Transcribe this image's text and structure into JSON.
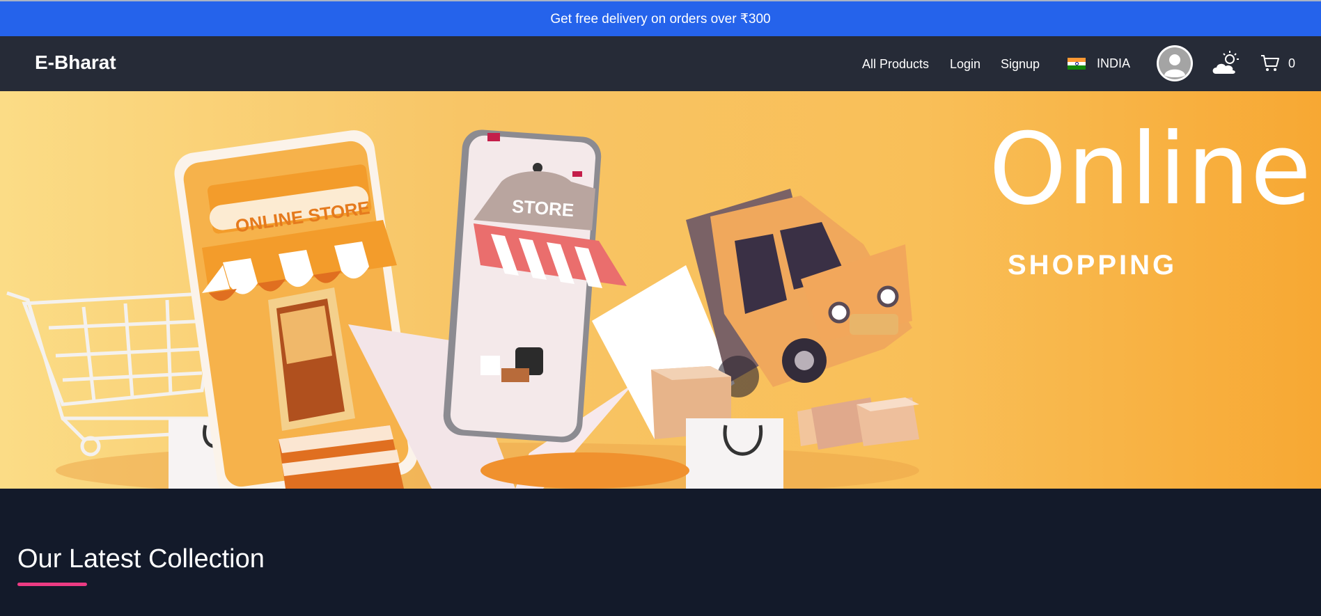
{
  "promo": {
    "text": "Get free delivery on orders over ₹300"
  },
  "navbar": {
    "brand": "E-Bharat",
    "links": {
      "all_products": "All Products",
      "login": "Login",
      "signup": "Signup"
    },
    "country": "INDIA",
    "cart_count": "0",
    "icons": [
      "india-flag-icon",
      "avatar-icon",
      "weather-icon",
      "cart-icon"
    ]
  },
  "hero": {
    "title": "Online.",
    "subtitle": "SHOPPING",
    "store_sign": "ONLINE STORE",
    "phone_sign": "STORE"
  },
  "section": {
    "title": "Our Latest Collection",
    "accent_color": "#ec3b83"
  },
  "colors": {
    "promo_bg": "#2563eb",
    "navbar_bg": "#262b37",
    "page_bg": "#131a2a",
    "hero_orange": "#f9b040"
  }
}
